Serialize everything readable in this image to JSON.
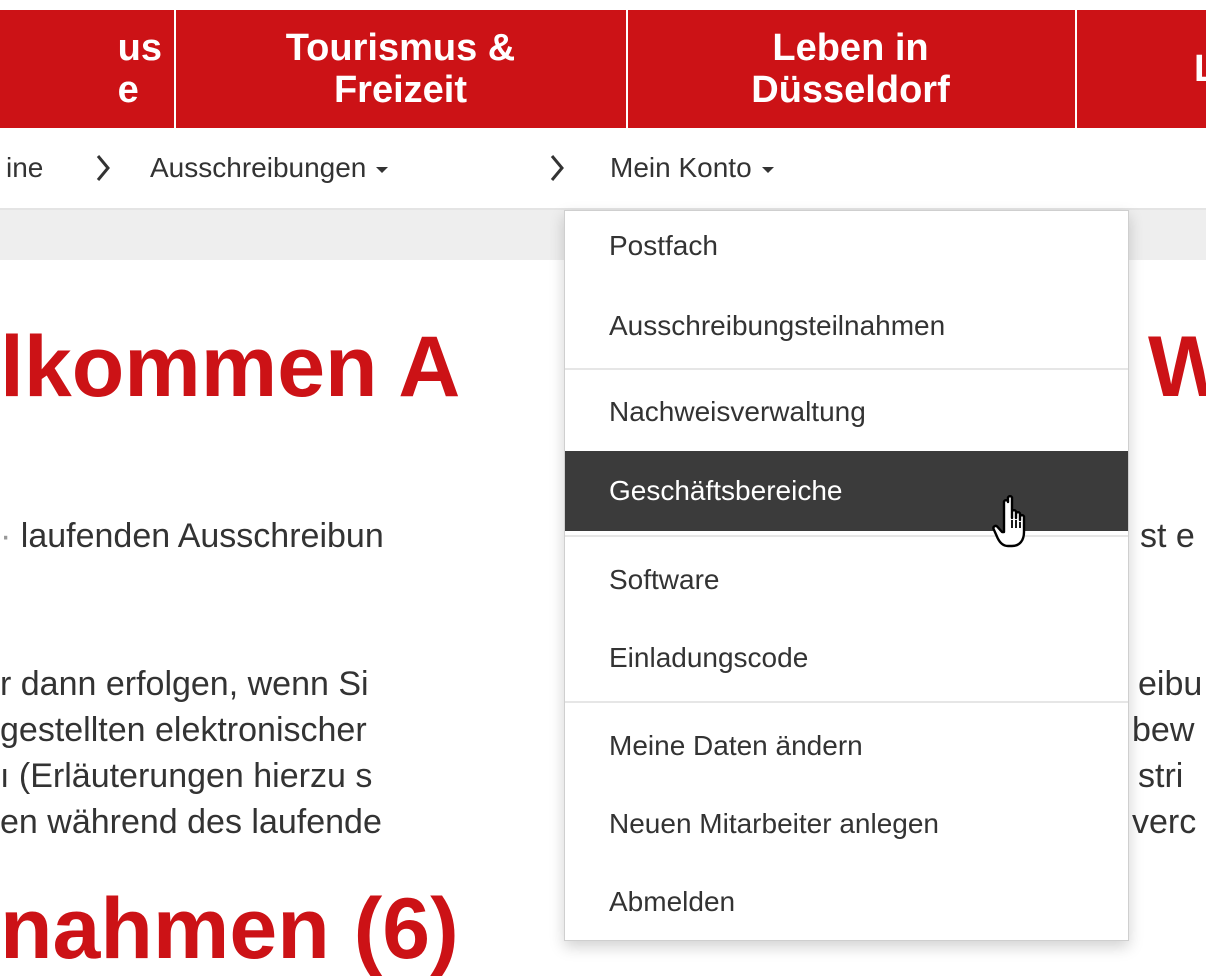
{
  "topnav": {
    "items": [
      {
        "label": "us\ne"
      },
      {
        "label": "Tourismus &\nFreizeit"
      },
      {
        "label": "Leben in\nDüsseldorf"
      },
      {
        "label": "L"
      }
    ],
    "background": "#cc1216"
  },
  "breadcrumb": {
    "items": [
      {
        "label": "ine"
      },
      {
        "label": "Ausschreibungen"
      },
      {
        "label": "Mein Konto"
      }
    ]
  },
  "content": {
    "heading1": "lkommen A",
    "heading1_right": "W",
    "line1_left": "laufenden Ausschreibun",
    "line1_right": "st e",
    "lines_left": [
      "r dann erfolgen, wenn Si",
      "gestellten elektronischer",
      "(Erläuterungen hierzu s",
      "en während des laufende"
    ],
    "lines_right": [
      "eibu",
      "bew",
      "stri",
      "verc"
    ],
    "heading2": "nahmen (6)"
  },
  "dropdown": {
    "items": [
      {
        "label": "Postfach"
      },
      {
        "label": "Ausschreibungsteilnahmen"
      },
      {
        "label": "Nachweisverwaltung"
      },
      {
        "label": "Geschäftsbereiche",
        "active": true
      },
      {
        "label": "Software"
      },
      {
        "label": "Einladungscode"
      },
      {
        "label": "Meine Daten ändern"
      },
      {
        "label": "Neuen Mitarbeiter anlegen"
      },
      {
        "label": "Abmelden"
      }
    ]
  },
  "colors": {
    "accent_red": "#cc1216",
    "menu_active_bg": "#3b3b3b"
  },
  "icons": {
    "cursor": "hand-pointer-icon"
  }
}
